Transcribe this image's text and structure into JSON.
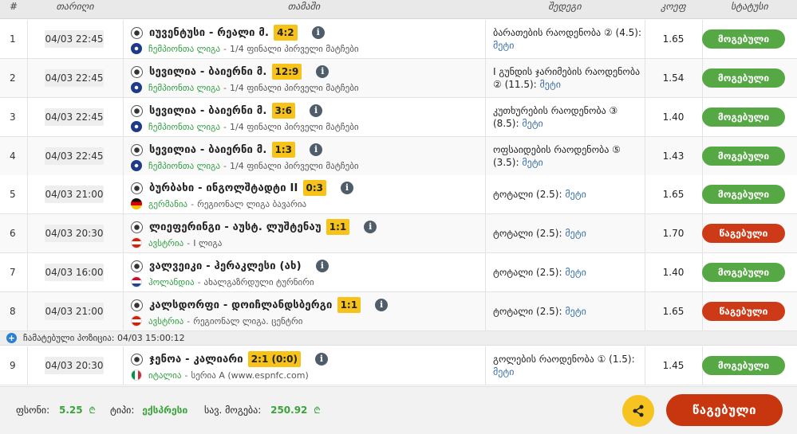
{
  "header": {
    "num": "#",
    "date": "თარიღი",
    "match": "თამაში",
    "result": "შედეგი",
    "odds": "კოეფ",
    "status": "სტატუსი"
  },
  "rows": [
    {
      "num": "1",
      "date": "04/03 22:45",
      "teams": "იუვენტუსი - რეალი მ.",
      "score": "4:2",
      "flag": "cl",
      "country": "ჩემპიონთა ლიგა",
      "league": "1/4 ფინალი პირველი მატჩები",
      "result_text": "ბარათების რაოდენობა ② (4.5):",
      "outcome": "მეტი",
      "odds": "1.65",
      "status": "მოგებული",
      "status_type": "won"
    },
    {
      "num": "2",
      "date": "04/03 22:45",
      "teams": "სევილია - ბაიერნი მ.",
      "score": "12:9",
      "flag": "cl",
      "country": "ჩემპიონთა ლიგა",
      "league": "1/4 ფინალი პირველი მატჩები",
      "result_text": "I გუნდის ჯარიმების რაოდენობა ② (11.5):",
      "outcome": "მეტი",
      "odds": "1.54",
      "status": "მოგებული",
      "status_type": "won"
    },
    {
      "num": "3",
      "date": "04/03 22:45",
      "teams": "სევილია - ბაიერნი მ.",
      "score": "3:6",
      "flag": "cl",
      "country": "ჩემპიონთა ლიგა",
      "league": "1/4 ფინალი პირველი მატჩები",
      "result_text": "კუთხურების რაოდენობა ③ (8.5):",
      "outcome": "მეტი",
      "odds": "1.40",
      "status": "მოგებული",
      "status_type": "won"
    },
    {
      "num": "4",
      "date": "04/03 22:45",
      "teams": "სევილია - ბაიერნი მ.",
      "score": "1:3",
      "flag": "cl",
      "country": "ჩემპიონთა ლიგა",
      "league": "1/4 ფინალი პირველი მატჩები",
      "result_text": "ოფსაიდების რაოდენობა ⑤ (3.5):",
      "outcome": "მეტი",
      "odds": "1.43",
      "status": "მოგებული",
      "status_type": "won"
    },
    {
      "num": "5",
      "date": "04/03 21:00",
      "teams": "ბურბახი - ინგოლშტადტი II",
      "score": "0:3",
      "flag": "de",
      "country": "გერმანია",
      "league": "რეგიონალ ლიგა ბავარია",
      "result_text": "ტოტალი (2.5):",
      "outcome": "მეტი",
      "odds": "1.65",
      "status": "მოგებული",
      "status_type": "won"
    },
    {
      "num": "6",
      "date": "04/03 20:30",
      "teams": "ლიეფერინგი - აუსტ. ლუშტენაუ",
      "score": "1:1",
      "flag": "at",
      "country": "ავსტრია",
      "league": "I ლიგა",
      "result_text": "ტოტალი (2.5):",
      "outcome": "მეტი",
      "odds": "1.70",
      "status": "წაგებული",
      "status_type": "lost"
    },
    {
      "num": "7",
      "date": "04/03 16:00",
      "teams": "ვალვეიკი - ჰერაკლესი (ახ)",
      "score": "",
      "flag": "nl",
      "country": "ჰოლანდია",
      "league": "ახალგაზრდული ტურნირი",
      "result_text": "ტოტალი (2.5):",
      "outcome": "მეტი",
      "odds": "1.40",
      "status": "მოგებული",
      "status_type": "won"
    },
    {
      "num": "8",
      "date": "04/03 21:00",
      "teams": "კალსდორფი - დოიჩლანდსბერგი",
      "score": "1:1",
      "flag": "at",
      "country": "ავსტრია",
      "league": "რეგიონალ ლიგა. ცენტრი",
      "result_text": "ტოტალი (2.5):",
      "outcome": "მეტი",
      "odds": "1.65",
      "status": "წაგებული",
      "status_type": "lost"
    },
    {
      "num": "9",
      "date": "04/03 20:30",
      "teams": "ჯენოა - კალიარი",
      "score": "2:1 (0:0)",
      "flag": "it",
      "country": "იტალია",
      "league": "სერია A (www.espnfc.com)",
      "result_text": "გოლების რაოდენობა ① (1.5):",
      "outcome": "მეტი",
      "odds": "1.45",
      "status": "მოგებული",
      "status_type": "won"
    }
  ],
  "changed_notice": "ჩამატებული პოზიცია: 04/03 15:00:12",
  "footer": {
    "stake_label": "ფსონი:",
    "stake_value": "5.25",
    "currency": "₾",
    "type_label": "ტიპი:",
    "type_value": "ექსპრესი",
    "win_label": "სავ. მოგება:",
    "win_value": "250.92",
    "final_status": "წაგებული"
  },
  "colors": {
    "won": "#56a845",
    "lost": "#cd3a18",
    "score": "#f7c31a",
    "share": "#f6c321",
    "country": "#2e9e3f",
    "outcome": "#3a70a8"
  },
  "icons": {
    "info": "info-icon",
    "ball": "football-icon",
    "share": "share-icon",
    "plus": "plus-circle-icon"
  }
}
